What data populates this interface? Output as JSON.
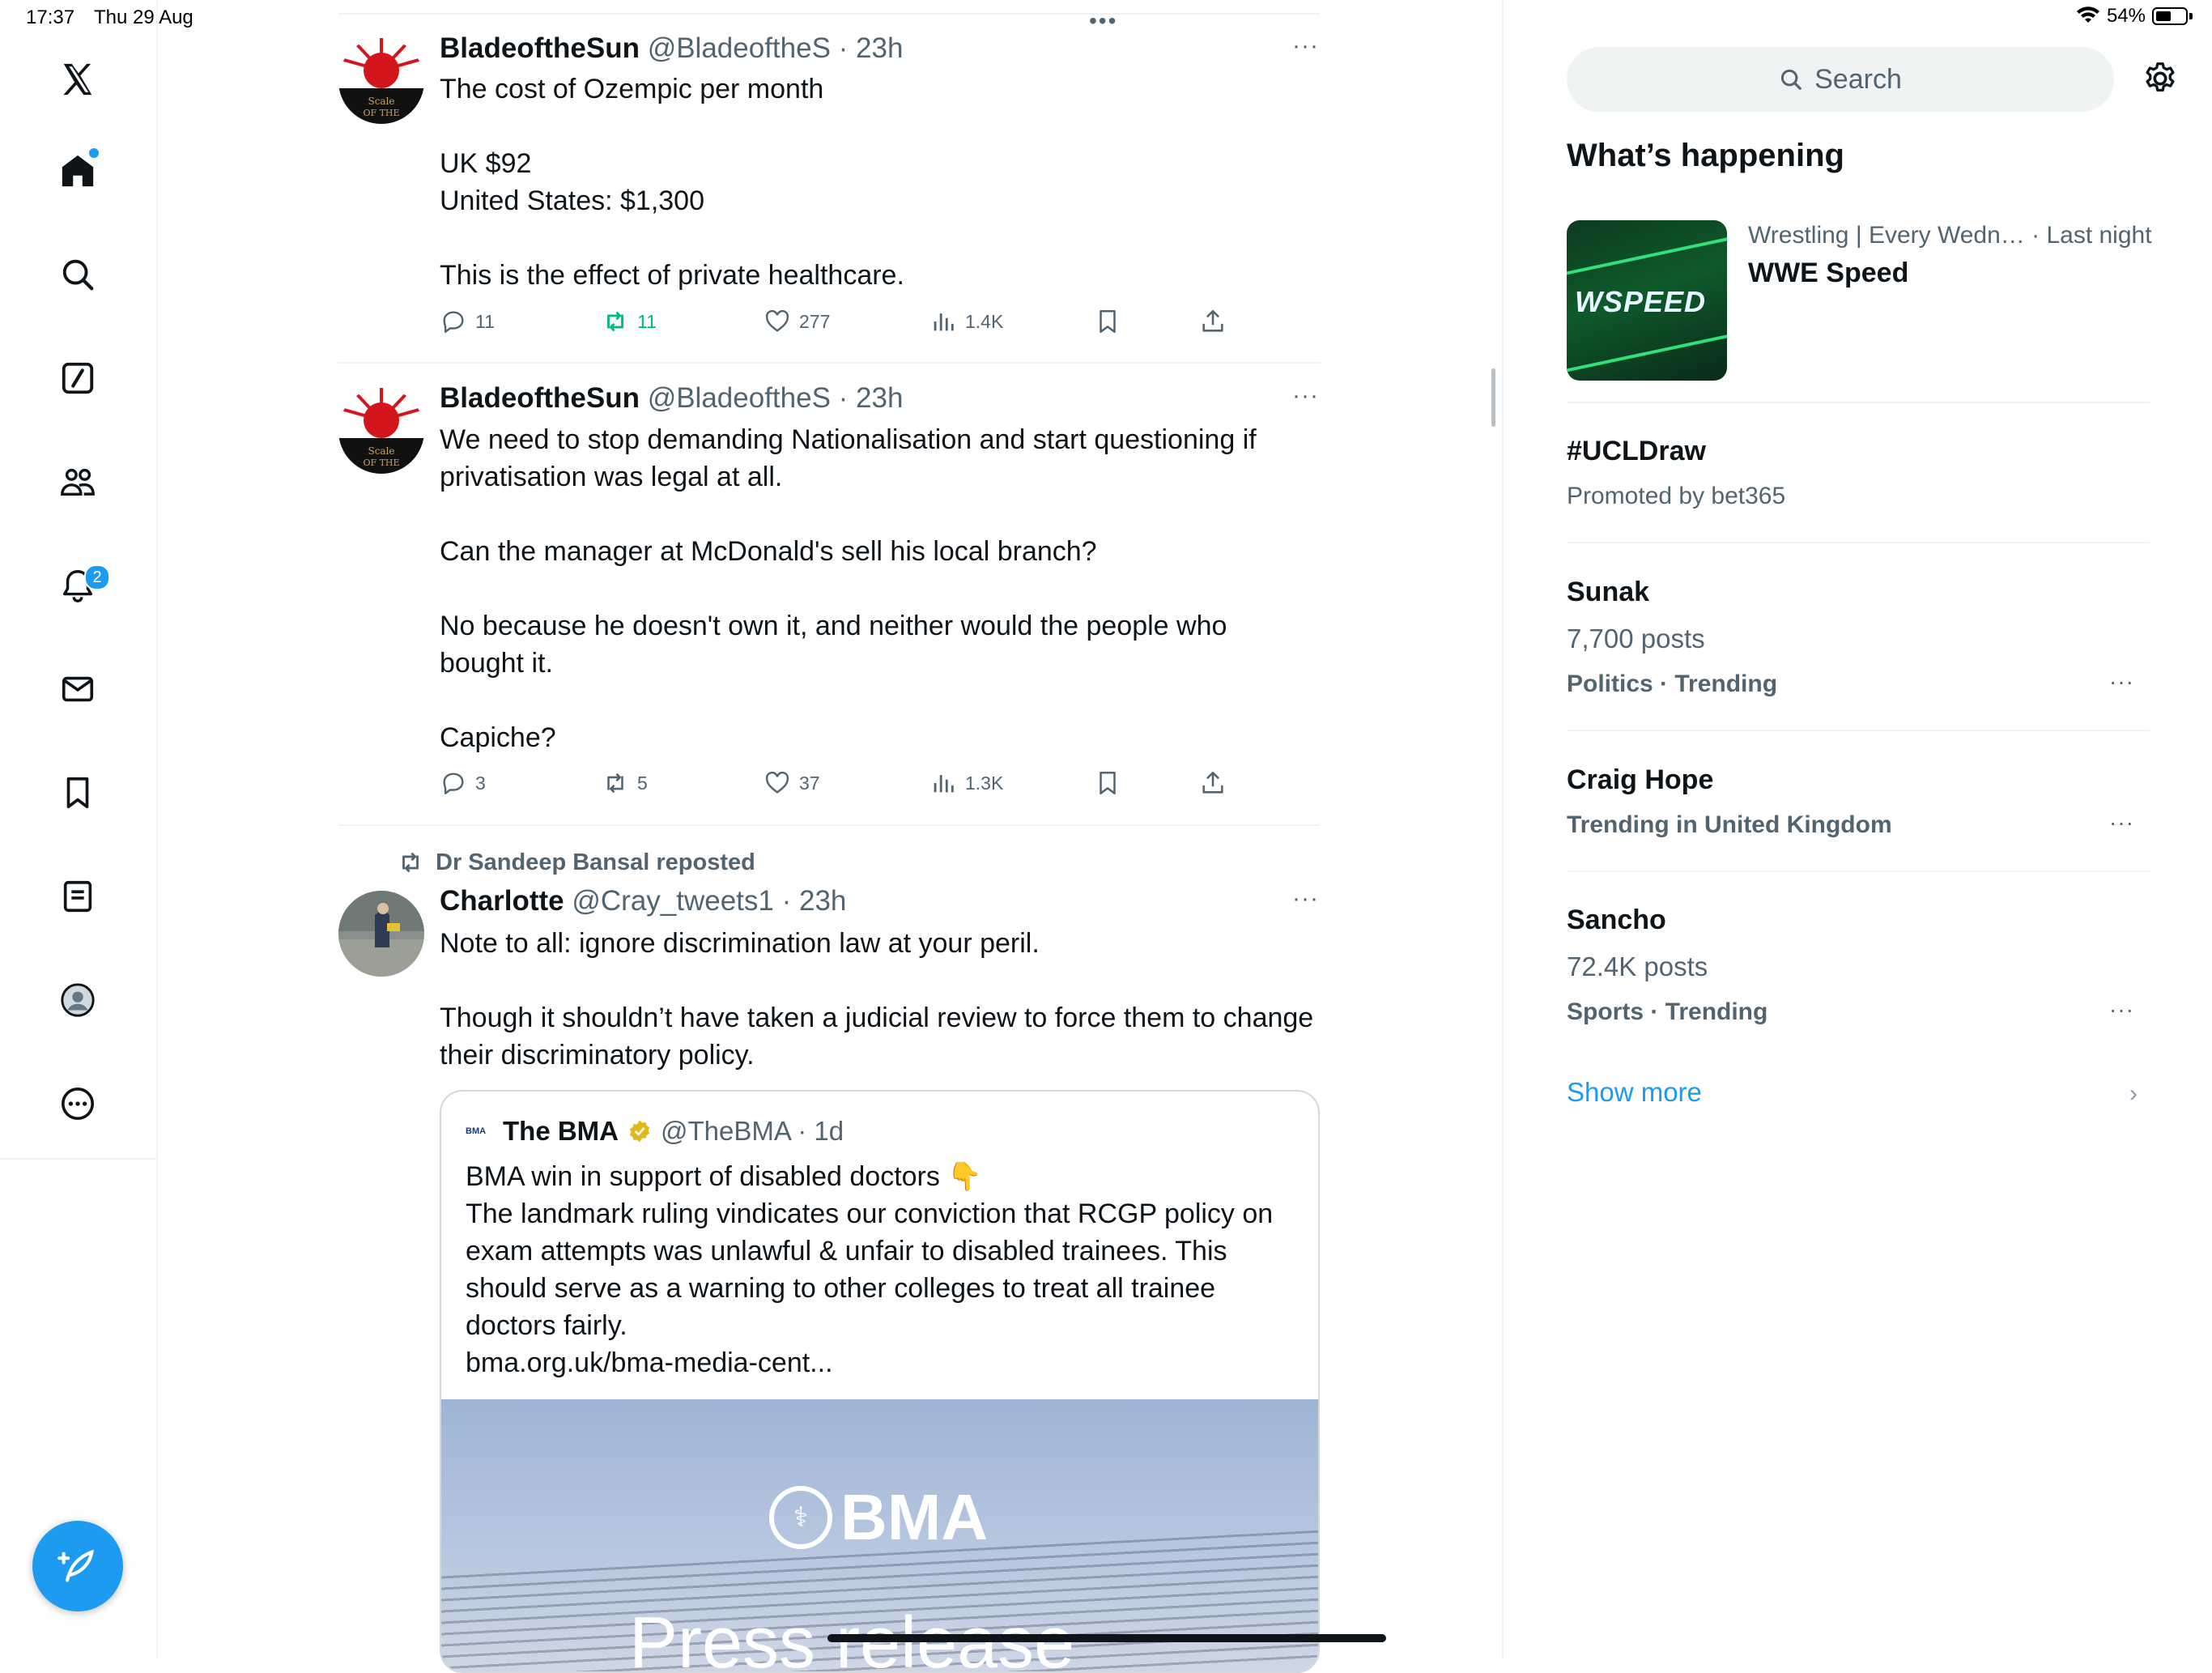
{
  "status_bar": {
    "time": "17:37",
    "date": "Thu 29 Aug",
    "battery": "54%",
    "battery_level": 0.54
  },
  "nav": {
    "items": [
      "X logo",
      "Home",
      "Explore",
      "Grok",
      "Communities",
      "Notifications",
      "Messages",
      "Bookmarks",
      "Lists",
      "Profile",
      "More"
    ],
    "notifications_badge": "2"
  },
  "feed": {
    "top_dots": "•••",
    "posts": [
      {
        "name": "BladeoftheSun",
        "meta": "@BladeoftheS · 23h",
        "text": "The cost of Ozempic per month\n\nUK $92\nUnited States: $1,300\n\nThis is the effect of private healthcare.",
        "replies": "11",
        "reposts": "11",
        "likes": "277",
        "views": "1.4K"
      },
      {
        "name": "BladeoftheSun",
        "meta": "@BladeoftheS · 23h",
        "text": "We need to stop demanding Nationalisation and start questioning if\nprivatisation was legal at all.\n\nCan the manager at McDonald's sell his local branch?\n\nNo because he doesn't own it, and neither would the people who\nbought it.\n\nCapiche?",
        "replies": "3",
        "reposts": "5",
        "likes": "37",
        "views": "1.3K"
      },
      {
        "repost_label": "Dr Sandeep Bansal reposted",
        "name": "Charlotte",
        "meta": "@Cray_tweets1 · 23h",
        "text": "Note to all: ignore discrimination law at your peril.\n\nThough it shouldn’t have taken a judicial review to force them to change\ntheir discriminatory policy."
      }
    ],
    "quote": {
      "logo_text": "BMA",
      "name": "The BMA",
      "meta": "@TheBMA · 1d",
      "text": "BMA win in support of disabled doctors 👇\nThe landmark ruling vindicates our conviction that RCGP policy on\nexam attempts was unlawful & unfair to disabled trainees. This\nshould serve as a warning to other colleges to treat all trainee\ndoctors fairly.\nbma.org.uk/bma-media-cent...",
      "image_logo": "BMA",
      "image_caption": "Press release"
    }
  },
  "sidebar": {
    "search_placeholder": "Search",
    "title": "What’s happening",
    "trends": [
      {
        "meta": "Wrestling | Every Wedn… · Last night",
        "name": "WWE Speed",
        "thumb_text": "WSPEED"
      },
      {
        "name": "#UCLDraw",
        "sub": "Promoted by bet365"
      },
      {
        "name": "Sunak",
        "posts": "7,700 posts",
        "category": "Politics · Trending"
      },
      {
        "name": "Craig Hope",
        "category": "Trending in United Kingdom"
      },
      {
        "name": "Sancho",
        "posts": "72.4K posts",
        "category": "Sports · Trending"
      }
    ],
    "more_icon": "···",
    "show_more": "Show more",
    "chevron": "›"
  },
  "colors": {
    "accent": "#1d9bf0",
    "repost_green": "#00ba7c",
    "text": "#0f1419",
    "secondary": "#536471"
  }
}
